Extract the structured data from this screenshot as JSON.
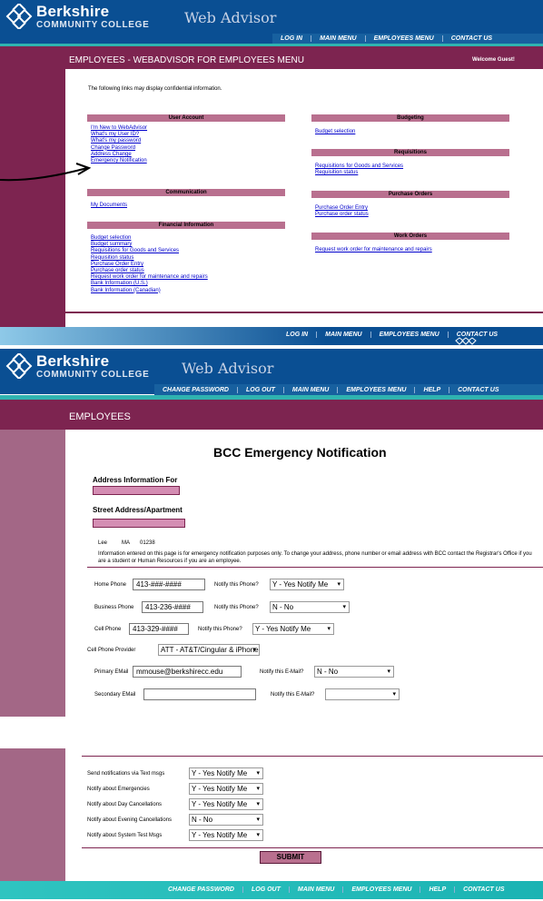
{
  "header": {
    "brand_top": "Berkshire",
    "brand_bottom": "COMMUNITY COLLEGE",
    "app_name": "Web Advisor"
  },
  "menu_page": {
    "nav": [
      "LOG IN",
      "MAIN MENU",
      "EMPLOYEES MENU",
      "CONTACT US"
    ],
    "title": "EMPLOYEES - WEBADVISOR FOR EMPLOYEES MENU",
    "welcome": "Welcome Guest!",
    "intro": "The following links may display confidential information.",
    "sections_left": [
      {
        "title": "User Account",
        "links": [
          "I'm New to WebAdvisor",
          "What's my User ID?",
          "What's my password",
          "Change Password",
          "Address Change",
          "Emergency Notification"
        ]
      },
      {
        "title": "Communication",
        "links": [
          "My Documents"
        ]
      },
      {
        "title": "Financial Information",
        "links": [
          "Budget selection",
          "Budget summary",
          "Requisitions for Goods and Services",
          "Requisition status",
          "Purchase Order Entry",
          "Purchase order status",
          "Request work order for maintenance and repairs",
          "Bank Information (U.S.)",
          "Bank Information (Canadian)"
        ]
      }
    ],
    "sections_right": [
      {
        "title": "Budgeting",
        "links": [
          "Budget selection"
        ]
      },
      {
        "title": "Requisitions",
        "links": [
          "Requisitions for Goods and Services",
          "Requisition status"
        ]
      },
      {
        "title": "Purchase Orders",
        "links": [
          "Purchase Order Entry",
          "Purchase order status"
        ]
      },
      {
        "title": "Work Orders",
        "links": [
          "Request work order for maintenance and repairs"
        ]
      }
    ],
    "footer_nav": [
      "LOG IN",
      "MAIN MENU",
      "EMPLOYEES MENU",
      "CONTACT US"
    ]
  },
  "form_page": {
    "nav": [
      "CHANGE PASSWORD",
      "LOG OUT",
      "MAIN MENU",
      "EMPLOYEES MENU",
      "HELP",
      "CONTACT US"
    ],
    "title": "EMPLOYEES",
    "heading": "BCC Emergency Notification",
    "address_for_label": "Address Information For",
    "street_label": "Street Address/Apartment",
    "city": "Lee",
    "state": "MA",
    "zip": "01238",
    "info_text": "Information entered on this page is for emergency notification purposes only. To change your address, phone number or email address with BCC contact the Registrar's Office if you are a student or Human Resources if you are an employee.",
    "home_phone_label": "Home Phone",
    "home_phone": "413-###-####",
    "notify_phone_label": "Notify this Phone?",
    "home_notify": "Y - Yes Notify Me",
    "business_phone_label": "Business Phone",
    "business_phone": "413-236-####",
    "business_notify": "N - No",
    "cell_phone_label": "Cell Phone",
    "cell_phone": "413-329-####",
    "cell_notify": "Y - Yes Notify Me",
    "provider_label": "Cell Phone Provider",
    "provider": "ATT - AT&T/Cingular & iPhone",
    "primary_email_label": "Primary EMail",
    "primary_email": "mmouse@berkshirecc.edu",
    "notify_email_label": "Notify this E-Mail?",
    "primary_email_notify": "N - No",
    "secondary_email_label": "Secondary EMail",
    "secondary_email": "",
    "secondary_email_notify": "",
    "prefs": [
      {
        "label": "Send notifications via Text msgs",
        "value": "Y - Yes Notify Me"
      },
      {
        "label": "Notify about Emergencies",
        "value": "Y - Yes Notify Me"
      },
      {
        "label": "Notify about Day Cancellations",
        "value": "Y - Yes Notify Me"
      },
      {
        "label": "Notify about Evening Cancellations",
        "value": "N - No"
      },
      {
        "label": "Notify about System Test Msgs",
        "value": "Y - Yes Notify Me"
      }
    ],
    "submit": "SUBMIT",
    "footer_nav": [
      "CHANGE PASSWORD",
      "LOG OUT",
      "MAIN MENU",
      "EMPLOYEES MENU",
      "HELP",
      "CONTACT US"
    ]
  }
}
